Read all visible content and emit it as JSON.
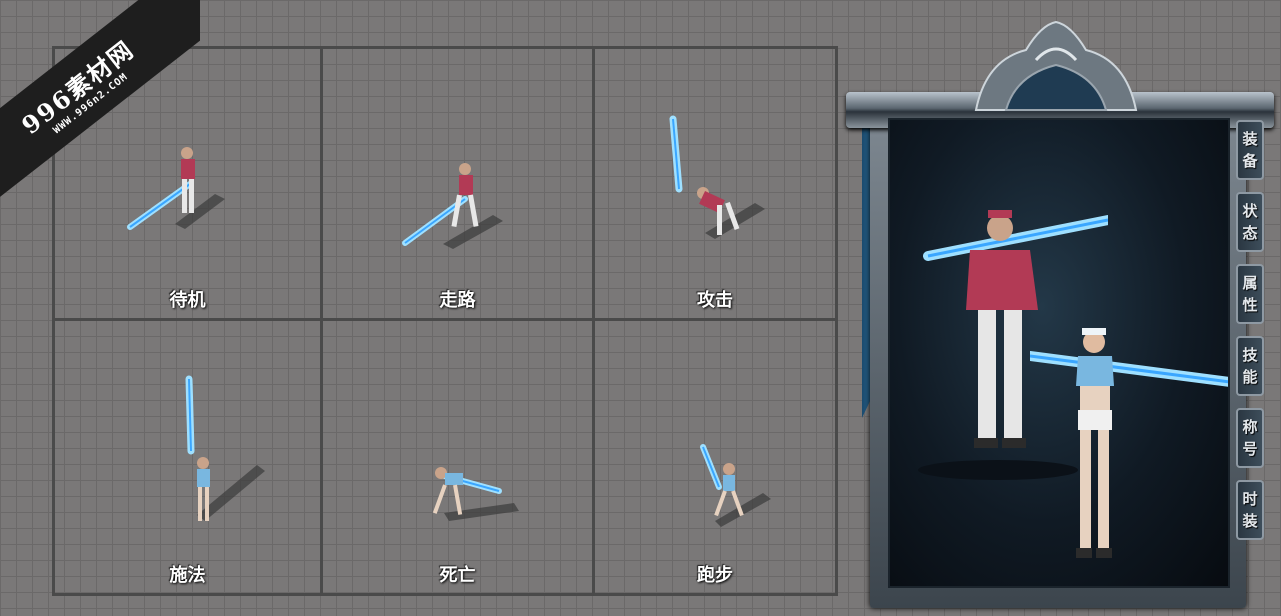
{
  "watermark": {
    "main": "996素材网",
    "sub": "WWW.996n2.COM"
  },
  "actions": [
    {
      "label": "待机"
    },
    {
      "label": "走路"
    },
    {
      "label": "攻击"
    },
    {
      "label": "施法"
    },
    {
      "label": "死亡"
    },
    {
      "label": "跑步"
    }
  ],
  "panel": {
    "tabs": [
      {
        "chars": [
          "装",
          "备"
        ]
      },
      {
        "chars": [
          "状",
          "态"
        ]
      },
      {
        "chars": [
          "属",
          "性"
        ]
      },
      {
        "chars": [
          "技",
          "能"
        ]
      },
      {
        "chars": [
          "称",
          "号"
        ]
      },
      {
        "chars": [
          "时",
          "装"
        ]
      }
    ]
  },
  "colors": {
    "accent": "#5fc3ff",
    "jersey": "#b23a55",
    "frame": "#5b6670"
  }
}
